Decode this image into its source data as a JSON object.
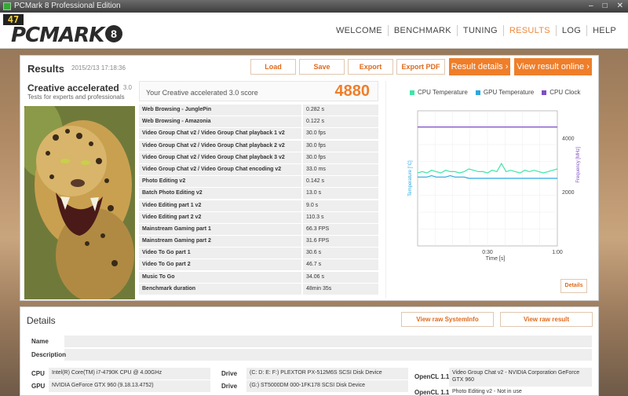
{
  "window": {
    "title": "PCMark 8 Professional Edition"
  },
  "logo": {
    "badge": "47",
    "text": "PCMARK",
    "num": "8"
  },
  "nav": [
    "WELCOME",
    "BENCHMARK",
    "TUNING",
    "RESULTS",
    "LOG",
    "HELP"
  ],
  "nav_active": "RESULTS",
  "results": {
    "title": "Results",
    "date": "2015/2/13 17:18:36",
    "buttons": {
      "load": "Load",
      "save": "Save",
      "export": "Export",
      "export_pdf": "Export PDF"
    },
    "result_details": "Result details",
    "view_online": "View result online"
  },
  "card": {
    "title": "Creative accelerated",
    "version": "3.0",
    "subtitle": "Tests for experts and professionals"
  },
  "score": {
    "label": "Your Creative accelerated 3.0 score",
    "value": "4880"
  },
  "rows": [
    {
      "name": "Web Browsing - JunglePin",
      "value": "0.282 s"
    },
    {
      "name": "Web Browsing - Amazonia",
      "value": "0.122 s"
    },
    {
      "name": "Video Group Chat v2 / Video Group Chat playback 1 v2",
      "value": "30.0 fps"
    },
    {
      "name": "Video Group Chat v2 / Video Group Chat playback 2 v2",
      "value": "30.0 fps"
    },
    {
      "name": "Video Group Chat v2 / Video Group Chat playback 3 v2",
      "value": "30.0 fps"
    },
    {
      "name": "Video Group Chat v2 / Video Group Chat encoding v2",
      "value": "33.0 ms"
    },
    {
      "name": "Photo Editing v2",
      "value": "0.142 s"
    },
    {
      "name": "Batch Photo Editing v2",
      "value": "13.0 s"
    },
    {
      "name": "Video Editing part 1 v2",
      "value": "9.0 s"
    },
    {
      "name": "Video Editing part 2 v2",
      "value": "110.3 s"
    },
    {
      "name": "Mainstream Gaming part 1",
      "value": "66.3 FPS"
    },
    {
      "name": "Mainstream Gaming part 2",
      "value": "31.6 FPS"
    },
    {
      "name": "Video To Go part 1",
      "value": "30.6 s"
    },
    {
      "name": "Video To Go part 2",
      "value": "46.7 s"
    },
    {
      "name": "Music To Go",
      "value": "34.06 s"
    },
    {
      "name": "Benchmark duration",
      "value": "48min 35s"
    }
  ],
  "chart": {
    "legend": [
      "CPU Temperature",
      "GPU Temperature",
      "CPU Clock"
    ],
    "colors": {
      "cpu_temp": "#3ee6a6",
      "gpu_temp": "#29a8e0",
      "cpu_clock": "#7e4fc6"
    },
    "left_axis_label": "Temperature [°C]",
    "right_axis_label": "Frequency [MHz]",
    "x_label": "Time [s]",
    "x_ticks": [
      "0:30",
      "1:00"
    ],
    "y2_ticks": [
      "4000",
      "2000"
    ],
    "details": "Details"
  },
  "chart_data": {
    "type": "line",
    "title": "",
    "xlabel": "Time [s]",
    "ylabel": "Temperature [°C]",
    "y2label": "Frequency [MHz]",
    "x_ticks": [
      "0:30",
      "1:00"
    ],
    "y2_ticks": [
      4000,
      2000
    ],
    "series": [
      {
        "name": "CPU Temperature",
        "axis": "left",
        "values": [
          54,
          55,
          54,
          56,
          55,
          54,
          56,
          55,
          55,
          54,
          55,
          57,
          56,
          55,
          55,
          54,
          56,
          55,
          61,
          55,
          56,
          55,
          54,
          56,
          55,
          56,
          55,
          54,
          55,
          56,
          57
        ]
      },
      {
        "name": "GPU Temperature",
        "axis": "left",
        "values": [
          51,
          51,
          51,
          52,
          51,
          51,
          51,
          52,
          51,
          51,
          51,
          50,
          50,
          50,
          50,
          50,
          50,
          50,
          50,
          50,
          50,
          50,
          50,
          50,
          50,
          50,
          50,
          50,
          50,
          50,
          50
        ]
      },
      {
        "name": "CPU Clock",
        "axis": "right",
        "values": [
          4400,
          4400,
          4400,
          4400,
          4400,
          4400,
          4400,
          4400,
          4400,
          4400,
          4400,
          4400,
          4400,
          4400,
          4400,
          4400,
          4400,
          4400,
          4400,
          4400,
          4400,
          4400,
          4400,
          4400,
          4400,
          4400,
          4400,
          4400,
          4400,
          4400,
          4400
        ]
      }
    ],
    "y_left_range": [
      0,
      100
    ],
    "y_right_range": [
      0,
      5000
    ],
    "grid": true
  },
  "details": {
    "title": "Details",
    "view_sysinfo": "View raw SystemInfo",
    "view_result": "View raw result",
    "name_label": "Name",
    "desc_label": "Description",
    "cpu_label": "CPU",
    "cpu_value": "Intel(R) Core(TM) i7-4790K CPU @ 4.00GHz",
    "gpu_label": "GPU",
    "gpu_value": "NVIDIA GeForce GTX 960 (9.18.13.4752)",
    "drive_label": "Drive",
    "drive1": "(C: D: E: F:) PLEXTOR PX-512M6S SCSI Disk Device",
    "drive2": "(G:) ST5000DM 000-1FK178 SCSI Disk Device",
    "opencl_label": "OpenCL 1.1",
    "opencl_value": "Video Group Chat v2 - NVIDIA Corporation GeForce GTX 960",
    "opencl2_partial": "Photo Editing v2 - Not in use"
  }
}
